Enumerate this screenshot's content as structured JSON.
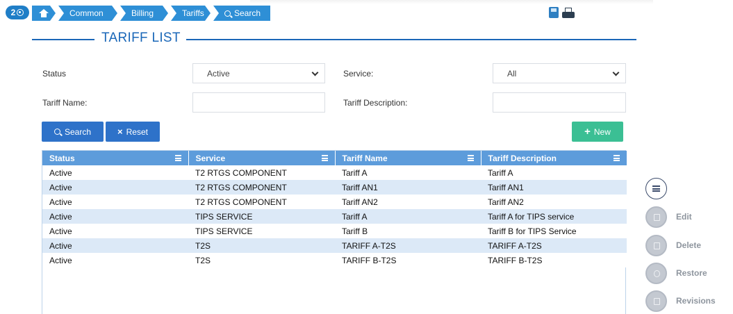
{
  "breadcrumb": {
    "badge_count": "2",
    "items": [
      "Common",
      "Billing",
      "Tariffs",
      "Search"
    ]
  },
  "page_title": "TARIFF LIST",
  "form": {
    "status_label": "Status",
    "status_value": "Active",
    "service_label": "Service:",
    "service_value": "All",
    "tariff_name_label": "Tariff Name:",
    "tariff_name_value": "",
    "tariff_description_label": "Tariff Description:",
    "tariff_description_value": ""
  },
  "buttons": {
    "search": "Search",
    "reset": "Reset",
    "new": "New",
    "reset_icon": "×",
    "new_icon": "+"
  },
  "table": {
    "columns": [
      "Status",
      "Service",
      "Tariff Name",
      "Tariff Description"
    ],
    "rows": [
      [
        "Active",
        "T2 RTGS COMPONENT",
        "Tariff A",
        "Tariff A"
      ],
      [
        "Active",
        "T2 RTGS COMPONENT",
        "Tariff AN1",
        "Tariff AN1"
      ],
      [
        "Active",
        "T2 RTGS COMPONENT",
        "Tariff AN2",
        "Tariff AN2"
      ],
      [
        "Active",
        "TIPS SERVICE",
        "Tariff A",
        "Tariff A for TIPS service"
      ],
      [
        "Active",
        "TIPS SERVICE",
        "Tariff B",
        "Tariff B for TIPS Service"
      ],
      [
        "Active",
        "T2S",
        "TARIFF A-T2S",
        "TARIFF A-T2S"
      ],
      [
        "Active",
        "T2S",
        "TARIFF B-T2S",
        "TARIFF B-T2S"
      ]
    ]
  },
  "side_actions": {
    "edit": "Edit",
    "delete": "Delete",
    "restore": "Restore",
    "revisions": "Revisions"
  },
  "colors": {
    "breadcrumb": "#2e8fd6",
    "title": "#1a67b8",
    "header": "#5d9cdb",
    "row_alt": "#dce9f7",
    "search_button": "#2e72c9",
    "new_button": "#3bbf94",
    "disabled_action": "#c4c9d1"
  },
  "icons": [
    "eye-icon",
    "home-icon",
    "search-icon",
    "save-icon",
    "print-icon",
    "column-menu-icon",
    "list-icon",
    "edit-icon",
    "delete-icon",
    "restore-icon",
    "revisions-icon"
  ]
}
